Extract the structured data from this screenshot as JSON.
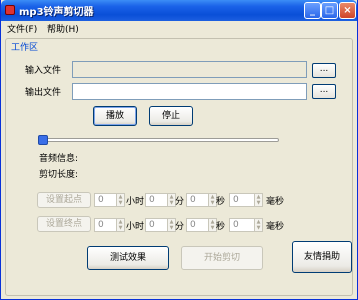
{
  "window": {
    "title": "mp3铃声剪切器"
  },
  "menu": {
    "file": "文件(F)",
    "help": "帮助(H)"
  },
  "group": {
    "title": "工作区"
  },
  "input_file": {
    "label": "输入文件",
    "value": "",
    "browse": "..."
  },
  "output_file": {
    "label": "输出文件",
    "value": "",
    "browse": "..."
  },
  "buttons": {
    "play": "播放",
    "stop": "停止",
    "test": "测试效果",
    "start_cut": "开始剪切",
    "donate": "友情捐助"
  },
  "slider": {
    "position": 0.0
  },
  "info": {
    "audio": "音频信息:",
    "cut_length": "剪切长度:"
  },
  "start_point": {
    "button": "设置起点",
    "hours": "0",
    "minutes": "0",
    "seconds": "0",
    "ms": "0"
  },
  "end_point": {
    "button": "设置终点",
    "hours": "0",
    "minutes": "0",
    "seconds": "0",
    "ms": "0"
  },
  "units": {
    "hours": "小时",
    "minutes": "分",
    "seconds": "秒",
    "ms": "毫秒"
  }
}
